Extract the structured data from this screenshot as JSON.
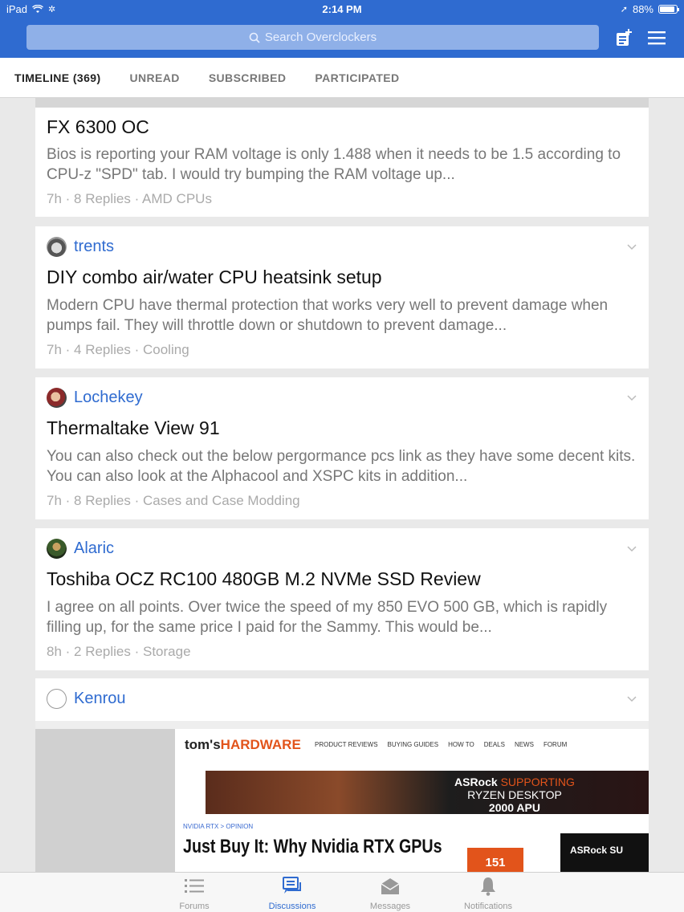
{
  "status_bar": {
    "device": "iPad",
    "time": "2:14 PM",
    "battery": "88%",
    "battery_level": 0.88
  },
  "header": {
    "search_placeholder": "Search Overclockers",
    "compose_icon": "compose-icon",
    "menu_icon": "hamburger-menu-icon"
  },
  "tabs": [
    {
      "label": "TIMELINE (369)",
      "active": true
    },
    {
      "label": "UNREAD",
      "active": false
    },
    {
      "label": "SUBSCRIBED",
      "active": false
    },
    {
      "label": "PARTICIPATED",
      "active": false
    }
  ],
  "posts": [
    {
      "author": "",
      "title": "FX 6300 OC",
      "excerpt": "Bios is reporting your RAM voltage is only 1.488 when it needs to be 1.5 according to CPU-z \"SPD\" tab. I would try bumping the RAM voltage up...",
      "meta": "7h · 8 Replies · AMD CPUs"
    },
    {
      "author": "trents",
      "title": "DIY combo air/water CPU heatsink setup",
      "excerpt": "Modern CPU have thermal protection that works very well to prevent damage when pumps fail. They will throttle down or shutdown to prevent damage...",
      "meta": "7h · 4 Replies · Cooling"
    },
    {
      "author": "Lochekey",
      "title": "Thermaltake View 91",
      "excerpt": "You can also check out the below pergormance pcs link as they have some decent kits. You can also look at the Alphacool and XSPC kits in addition...",
      "meta": "7h · 8 Replies · Cases and Case Modding"
    },
    {
      "author": "Alaric",
      "title": "Toshiba OCZ RC100 480GB M.2 NVMe SSD Review",
      "excerpt": "I agree on all points. Over twice the speed of my 850 EVO 500 GB, which is rapidly filling up, for the same price I paid for the Sammy. This would be...",
      "meta": "8h · 2 Replies · Storage"
    },
    {
      "author": "Kenrou",
      "embed": {
        "logo_a": "tom's",
        "logo_b": "HARDWARE",
        "nav": [
          "PRODUCT REVIEWS",
          "BUYING GUIDES",
          "HOW TO",
          "DEALS",
          "NEWS",
          "FORUM"
        ],
        "banner_brand": "ASRock",
        "banner_line1": "SUPPORTING",
        "banner_line2": "RYZEN DESKTOP",
        "banner_line3": "2000 APU",
        "crumb": "NVIDIA RTX > OPINION",
        "headline": "Just Buy It: Why Nvidia RTX GPUs",
        "badge": "151",
        "ad_text": "ASRock SU"
      }
    }
  ],
  "tabbar": [
    {
      "label": "Forums",
      "icon": "list-icon",
      "active": false
    },
    {
      "label": "Discussions",
      "icon": "discussions-icon",
      "active": true
    },
    {
      "label": "Messages",
      "icon": "envelope-icon",
      "active": false
    },
    {
      "label": "Notifications",
      "icon": "bell-icon",
      "active": false
    }
  ],
  "colors": {
    "brand": "#2f6bd0",
    "background": "#e9e9e9",
    "accent_orange": "#e2541b"
  }
}
